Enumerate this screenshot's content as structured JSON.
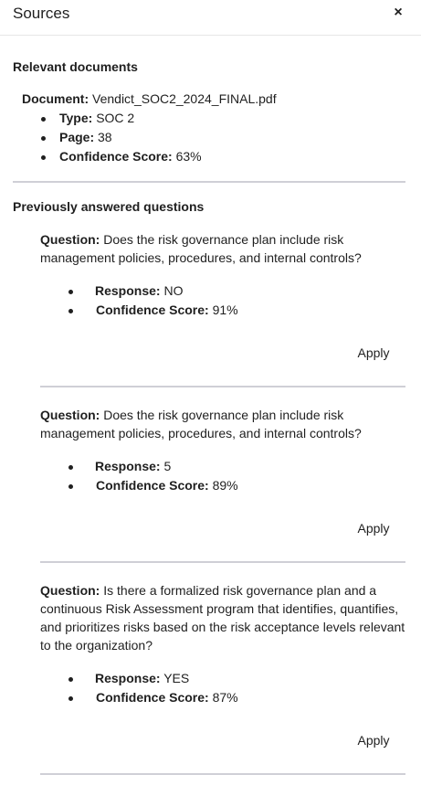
{
  "header": {
    "title": "Sources",
    "close_symbol": "×"
  },
  "relevant": {
    "heading": "Relevant documents",
    "document_label": "Document:",
    "document_name": "Vendict_SOC2_2024_FINAL.pdf",
    "type_label": "Type:",
    "type_value": "SOC 2",
    "page_label": "Page:",
    "page_value": "38",
    "confidence_label": "Confidence Score:",
    "confidence_value": "63%"
  },
  "previous": {
    "heading": "Previously answered questions",
    "question_label": "Question:",
    "response_label": "Response:",
    "confidence_label": "Confidence Score:",
    "apply_label": "Apply",
    "items": [
      {
        "question": "Does the risk governance plan include risk management policies, procedures, and internal controls?",
        "response": "NO",
        "confidence": "91%"
      },
      {
        "question": "Does the risk governance plan include risk management policies, procedures, and internal controls?",
        "response": "5",
        "confidence": "89%"
      },
      {
        "question": "Is there a formalized risk governance plan and a continuous Risk Assessment program that identifies, quantifies, and prioritizes risks based on the risk acceptance levels relevant to the organization?",
        "response": "YES",
        "confidence": "87%"
      }
    ]
  }
}
